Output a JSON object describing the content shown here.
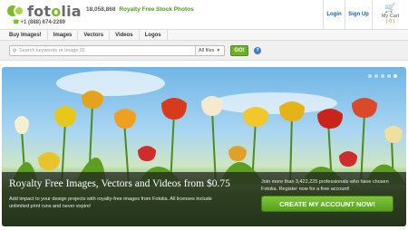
{
  "header": {
    "logo_prefix": "fot",
    "logo_accent": "o",
    "logo_suffix": "lia",
    "phone": "+1 (888) 674-2289",
    "image_count": "18,058,868",
    "tagline": "Royalty Free Stock Photos",
    "links": {
      "login": "Login",
      "signup": "Sign Up",
      "cart": "My Cart",
      "cart_count": "( 0 )"
    }
  },
  "nav": {
    "items": [
      "Buy Images!",
      "Images",
      "Vectors",
      "Videos",
      "Logos"
    ]
  },
  "search": {
    "placeholder": "Search keywords or Image ID",
    "filter": "All files",
    "go_label": "GO!",
    "help": "?"
  },
  "hero": {
    "title": "Royalty Free Images, Vectors and Videos from $0.75",
    "description": "Add impact to your design projects with royalty-free images from Fotolia. All licenses include unlimited print runs and never expire!",
    "cta_text": "Join more than 3,422,225 professionals who have chosen Fotolia. Register now for a free account!",
    "cta_button": "CREATE MY ACCOUNT NOW!",
    "slides": 5,
    "active_slide": 5
  },
  "colors": {
    "brand_green": "#7dbb2a",
    "link_blue": "#1d5ea8",
    "cta_green": "#55a01c"
  },
  "icons": {
    "phone": "phone-icon",
    "cart": "cart-icon",
    "search": "search-icon",
    "help": "help-icon"
  }
}
